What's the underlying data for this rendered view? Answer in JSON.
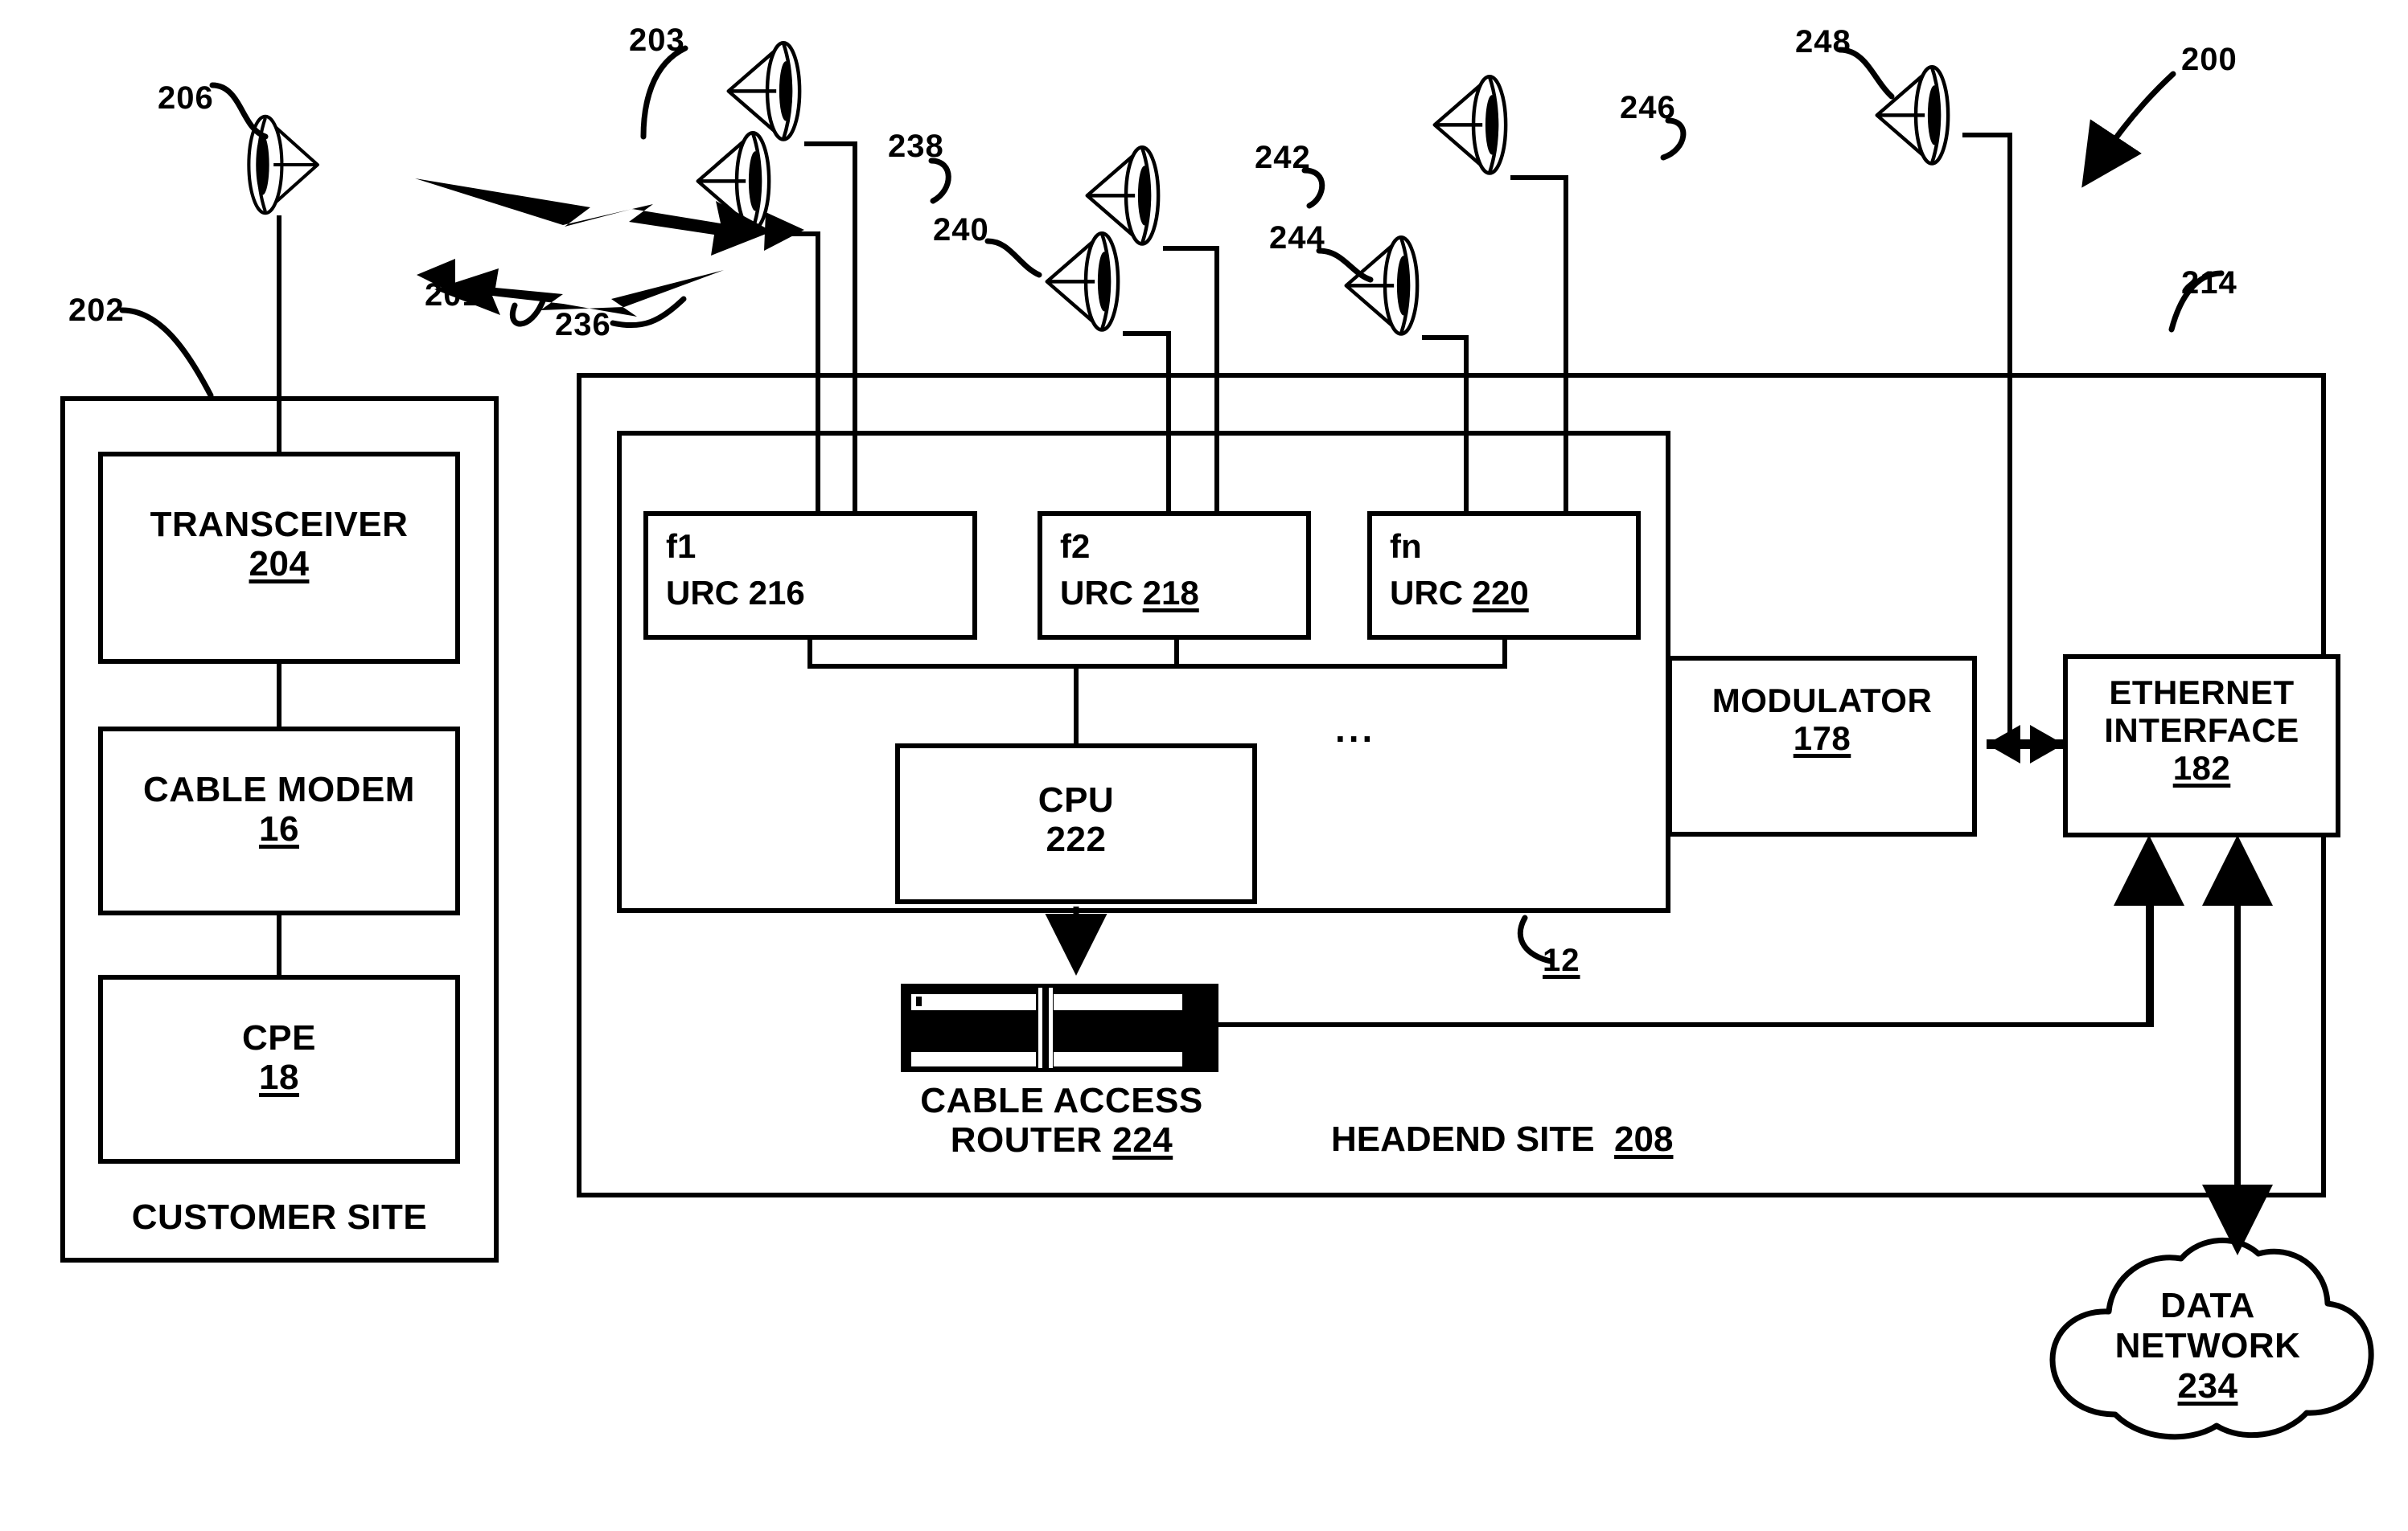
{
  "figure": {
    "id": "200",
    "headend_site": {
      "label": "HEADEND SITE",
      "ref": "208"
    },
    "customer_site": {
      "label": "CUSTOMER SITE",
      "ref": "202"
    },
    "inner_system_ref": "12",
    "outer_system_ref": "214"
  },
  "customer": {
    "transceiver": {
      "label": "TRANSCEIVER",
      "ref": "204"
    },
    "cable_modem": {
      "label": "CABLE MODEM",
      "ref": "16"
    },
    "cpe": {
      "label": "CPE",
      "ref": "18"
    },
    "antenna_ref": "206",
    "site_label": "CUSTOMER SITE",
    "site_ref": "202"
  },
  "links": {
    "downstream_ref": "203",
    "upstream_ref": "201"
  },
  "urcs": [
    {
      "freq": "f1",
      "label": "URC 216",
      "name": "URC",
      "ref": "216",
      "underline": false
    },
    {
      "freq": "f2",
      "label": "URC 218",
      "name": "URC",
      "ref": "218",
      "underline": true
    },
    {
      "freq": "fn",
      "label": "URC 220",
      "name": "URC",
      "ref": "220",
      "underline": true
    }
  ],
  "cpu": {
    "label": "CPU",
    "ref": "222"
  },
  "ellipsis": "...",
  "modulator": {
    "label": "MODULATOR",
    "ref": "178"
  },
  "ethernet": {
    "line1": "ETHERNET",
    "line2": "INTERFACE",
    "ref": "182"
  },
  "router": {
    "line1": "CABLE ACCESS",
    "line2": "ROUTER",
    "ref": "224"
  },
  "data_network": {
    "line1": "DATA",
    "line2": "NETWORK",
    "ref": "234"
  },
  "antennas": [
    {
      "ref": "236",
      "name": "headend-antenna-236"
    },
    {
      "ref": "238",
      "name": "headend-antenna-238"
    },
    {
      "ref": "240",
      "name": "headend-antenna-240"
    },
    {
      "ref": "242",
      "name": "headend-antenna-242"
    },
    {
      "ref": "244",
      "name": "headend-antenna-244"
    },
    {
      "ref": "246",
      "name": "headend-antenna-246"
    },
    {
      "ref": "248",
      "name": "headend-antenna-248"
    }
  ],
  "headend_site_label": "HEADEND SITE",
  "headend_site_ref": "208",
  "colors": {
    "ink": "#000000",
    "paper": "#ffffff"
  }
}
